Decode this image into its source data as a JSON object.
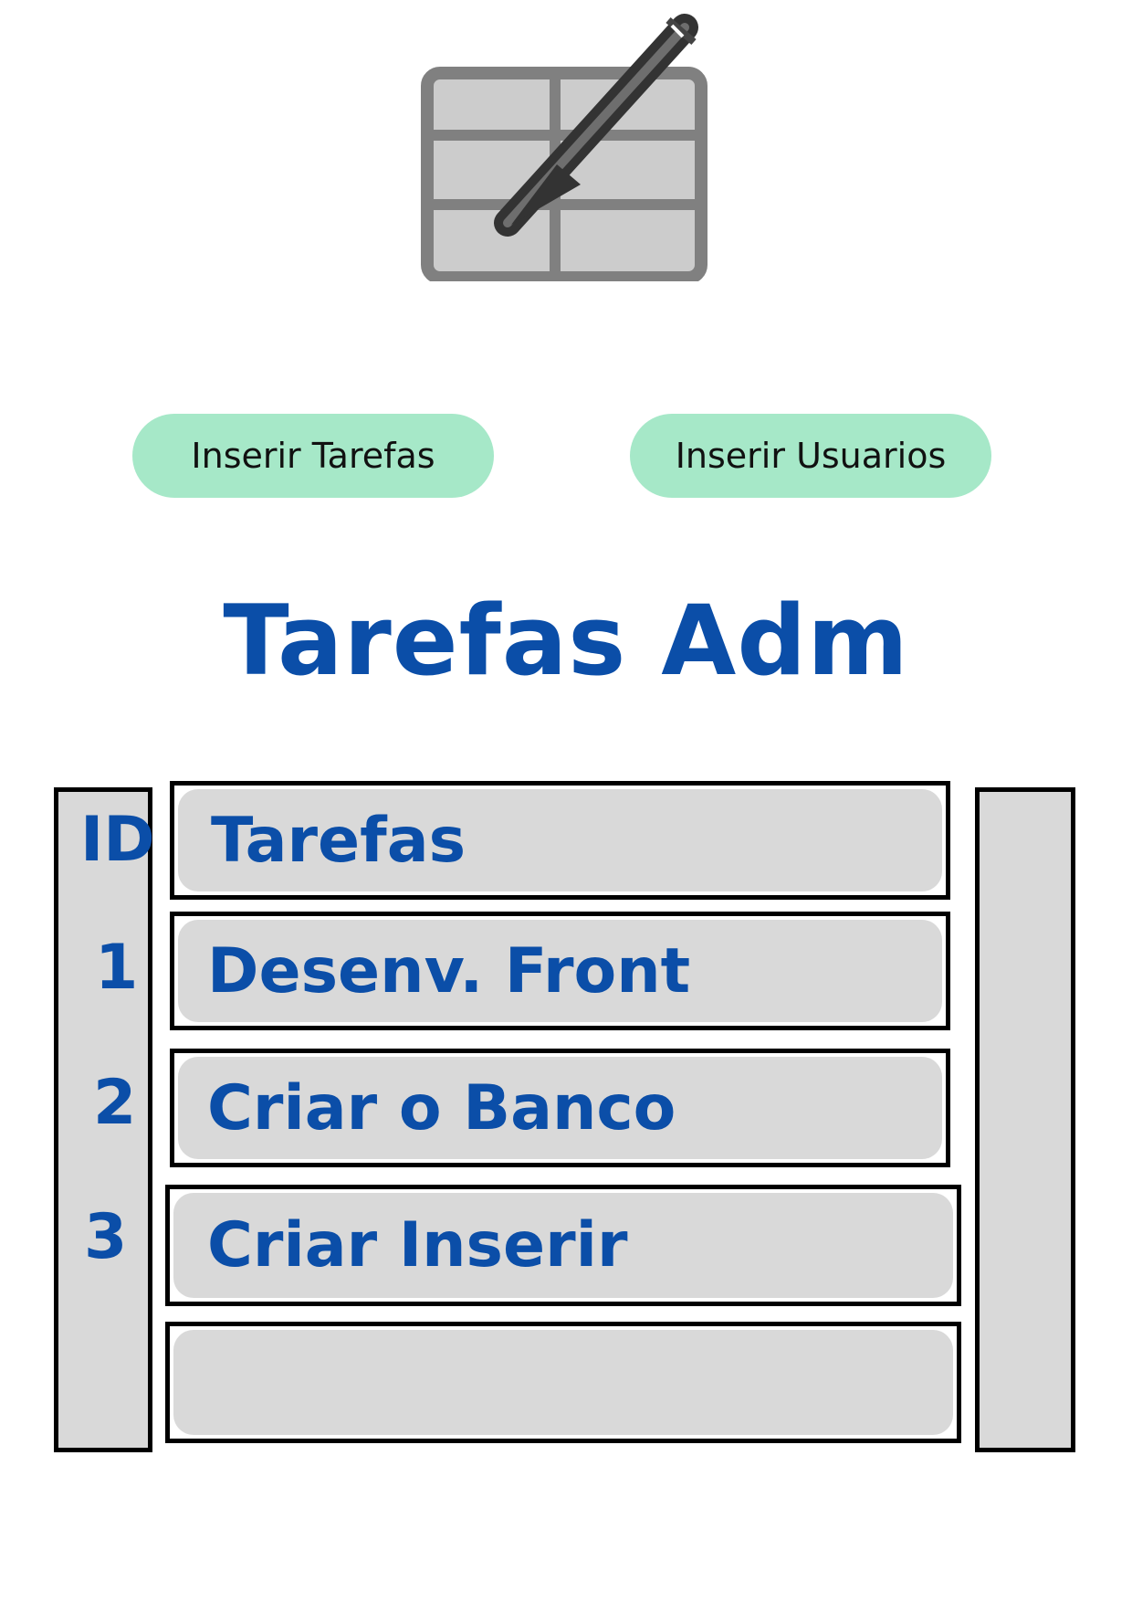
{
  "app": {
    "logo_icon": "spreadsheet-edit-icon"
  },
  "nav": {
    "insert_tasks_label": "Inserir Tarefas",
    "insert_users_label": "Inserir Usuarios"
  },
  "page": {
    "title": "Tarefas Adm"
  },
  "table": {
    "id_header": "ID",
    "task_header": "Tarefas",
    "rows": [
      {
        "id": "1",
        "task": "Desenv. Front"
      },
      {
        "id": "2",
        "task": "Criar o Banco"
      },
      {
        "id": "3",
        "task": "Criar Inserir"
      },
      {
        "id": "",
        "task": ""
      }
    ]
  },
  "colors": {
    "accent_button": "#a6e8c8",
    "title_blue": "#0b4ea8",
    "cell_gray": "#d9d9d9"
  }
}
